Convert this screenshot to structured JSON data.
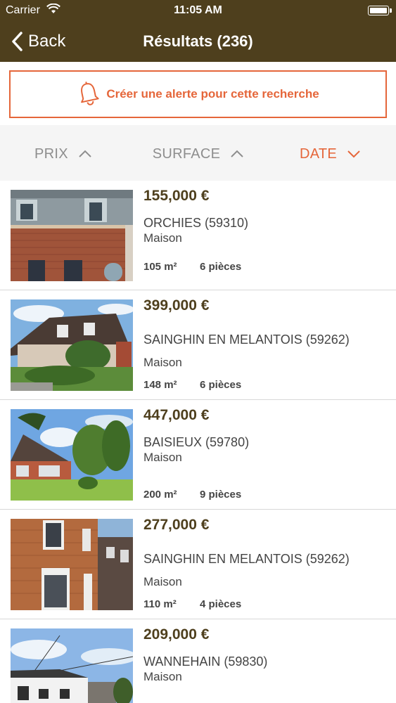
{
  "status_bar": {
    "carrier": "Carrier",
    "time": "11:05 AM"
  },
  "nav": {
    "back_label": "Back",
    "title": "Résultats (236)"
  },
  "alert": {
    "label": "Créer une alerte pour cette recherche",
    "icon": "bell-icon"
  },
  "sort_tabs": [
    {
      "label": "PRIX",
      "direction": "up",
      "active": false
    },
    {
      "label": "SURFACE",
      "direction": "up",
      "active": false
    },
    {
      "label": "DATE",
      "direction": "down",
      "active": true
    }
  ],
  "listings": [
    {
      "price": "155,000 €",
      "city": "ORCHIES (59310)",
      "type": "Maison",
      "surface": "105 m²",
      "rooms": "6 pièces"
    },
    {
      "price": "399,000 €",
      "city": "SAINGHIN EN MELANTOIS (59262)",
      "type": "Maison",
      "surface": "148 m²",
      "rooms": "6 pièces"
    },
    {
      "price": "447,000 €",
      "city": "BAISIEUX (59780)",
      "type": "Maison",
      "surface": "200 m²",
      "rooms": "9 pièces"
    },
    {
      "price": "277,000 €",
      "city": "SAINGHIN EN MELANTOIS (59262)",
      "type": "Maison",
      "surface": "110 m²",
      "rooms": "4 pièces"
    },
    {
      "price": "209,000 €",
      "city": "WANNEHAIN (59830)",
      "type": "Maison",
      "surface": "",
      "rooms": ""
    }
  ],
  "colors": {
    "header": "#4e3f1d",
    "accent": "#e5663a",
    "price": "#4e3f1d"
  }
}
